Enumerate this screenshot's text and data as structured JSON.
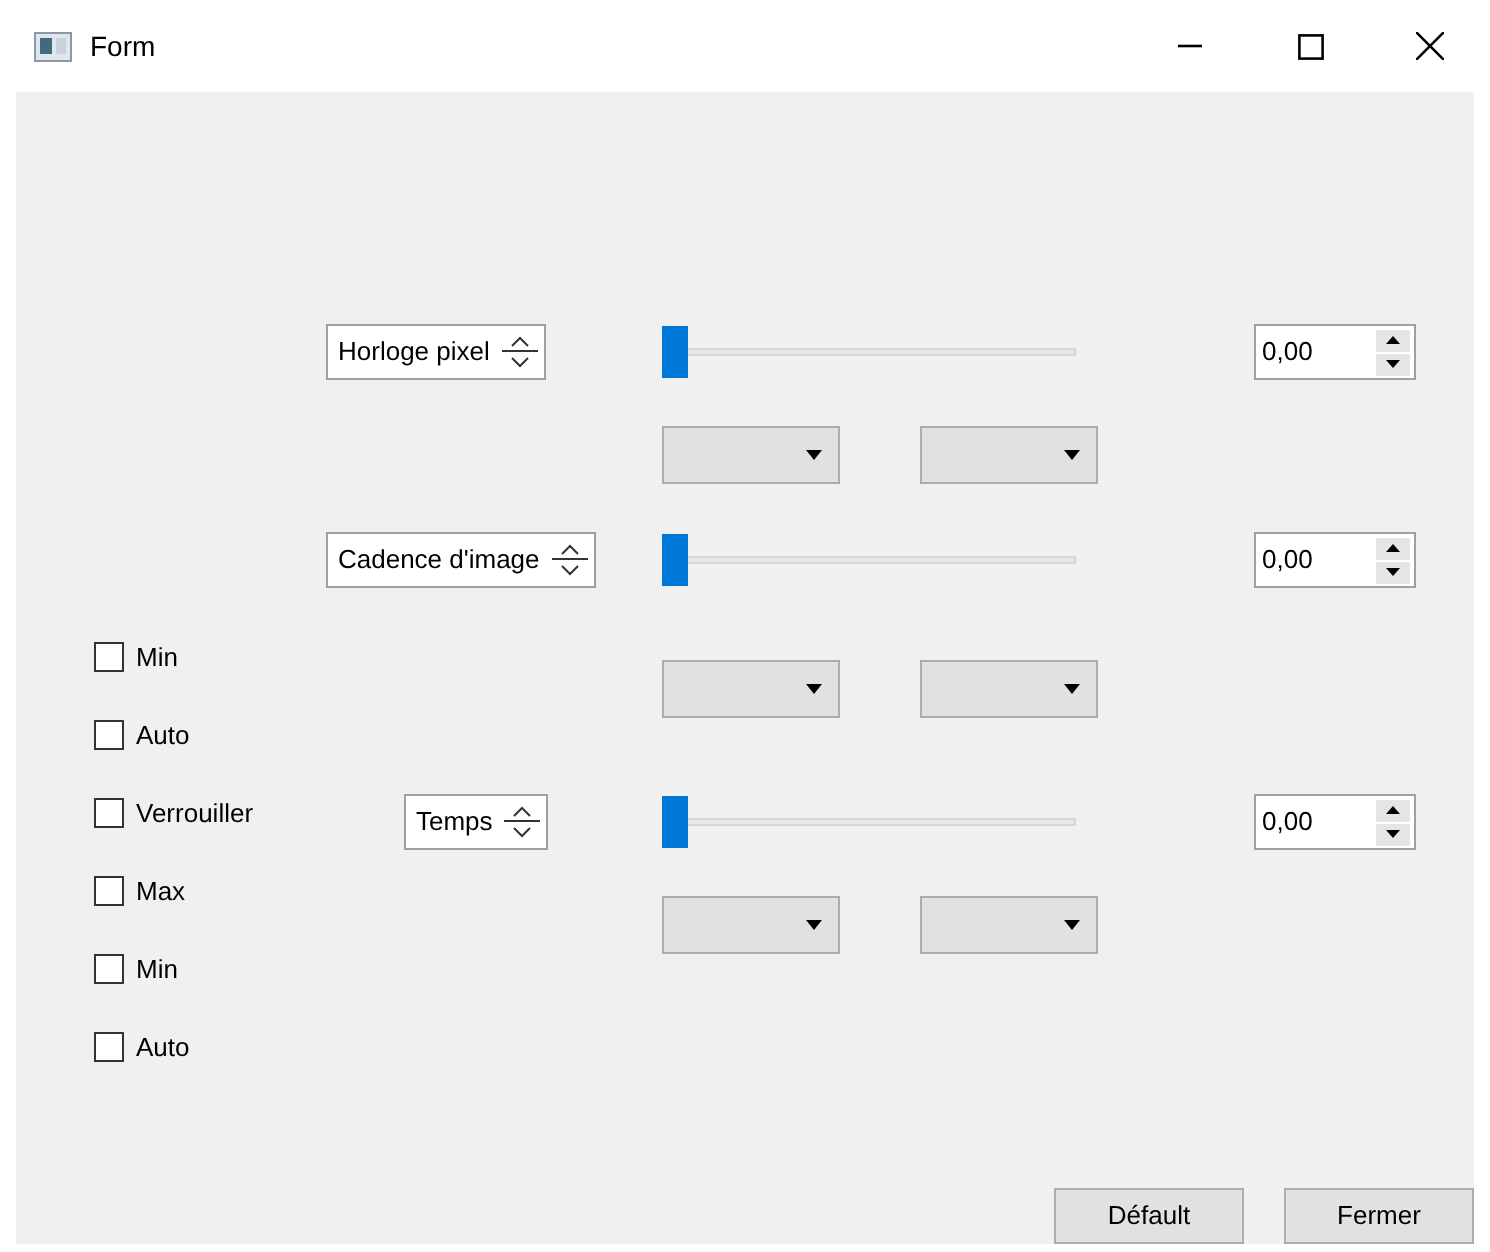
{
  "window": {
    "title": "Form"
  },
  "controls": [
    {
      "selector": "Horloge pixel",
      "level": 0,
      "value": "0,00"
    },
    {
      "selector": "Cadence d'image",
      "level": 0,
      "value": "0,00"
    },
    {
      "selector": "Temps",
      "level": 0,
      "value": "0,00"
    }
  ],
  "checkboxes": [
    {
      "label": "Min",
      "checked": false
    },
    {
      "label": "Auto",
      "checked": false
    },
    {
      "label": "Verrouiller",
      "checked": false
    },
    {
      "label": "Max",
      "checked": false
    },
    {
      "label": "Min",
      "checked": false
    },
    {
      "label": "Auto",
      "checked": false
    }
  ],
  "buttons": [
    "Défault",
    "Fermer"
  ]
}
